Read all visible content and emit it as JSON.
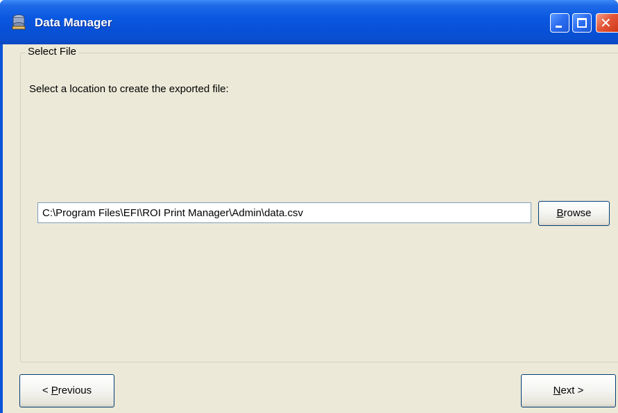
{
  "window": {
    "title": "Data Manager",
    "title_icon": "data-manager-app-icon",
    "controls": {
      "minimize_icon": "minimize-icon",
      "maximize_icon": "maximize-icon",
      "close_icon": "close-icon"
    }
  },
  "groupbox": {
    "label": "Select File"
  },
  "content": {
    "instruction": "Select a location to create the exported file:",
    "file_path": "C:\\Program Files\\EFI\\ROI Print Manager\\Admin\\data.csv",
    "browse_button": {
      "mnemonic": "B",
      "rest": "rowse"
    }
  },
  "navigation": {
    "previous_button": {
      "prefix": "< ",
      "mnemonic": "P",
      "rest": "revious"
    },
    "next_button": {
      "mnemonic": "N",
      "rest": "ext >"
    }
  },
  "colors": {
    "titlebar": "#0a58e0",
    "client_background": "#ece9d8",
    "close_button": "#e4583a",
    "input_border": "#7f9db9",
    "button_border": "#003c74"
  }
}
